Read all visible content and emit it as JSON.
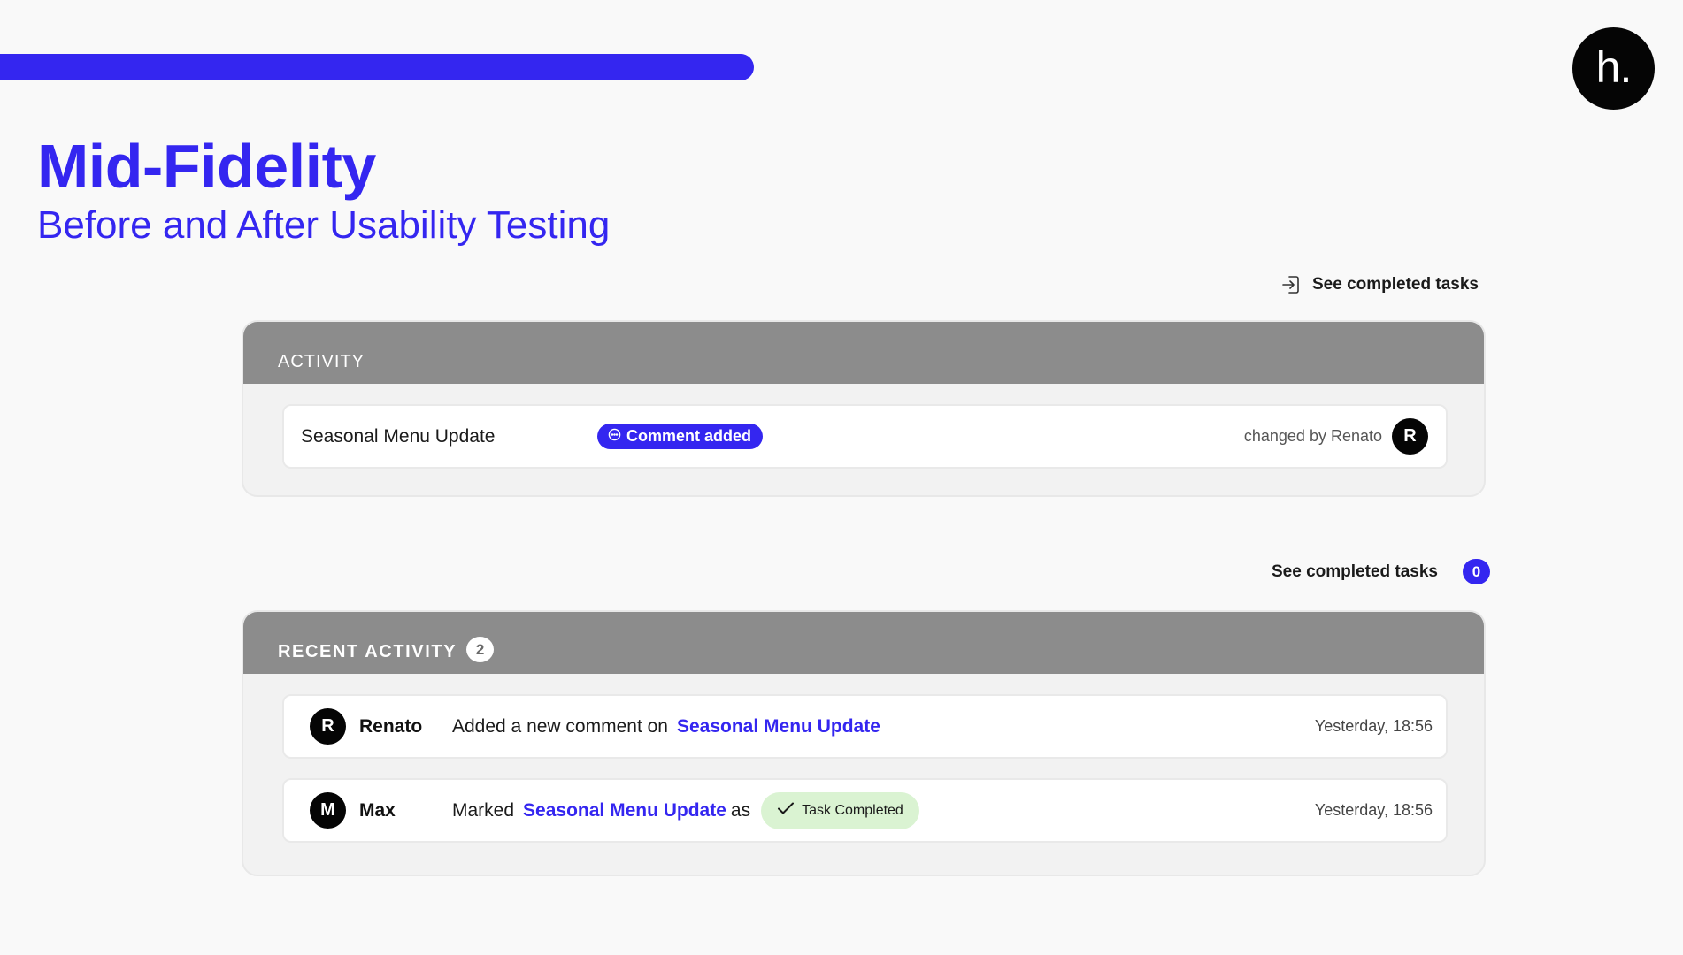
{
  "brand": {
    "logo_text": "h.",
    "accent_color": "#3426f0"
  },
  "page": {
    "title": "Mid-Fidelity",
    "subtitle": "Before and After Usability Testing"
  },
  "before": {
    "link_label": "See completed tasks",
    "link_icon": "exit-arrow-icon",
    "card_header": "ACTIVITY",
    "row": {
      "title": "Seasonal Menu Update",
      "badge_icon": "comment-icon",
      "badge_label": "Comment added",
      "changed_by": "changed by Renato",
      "avatar_initial": "R"
    }
  },
  "after": {
    "link_label": "See completed tasks",
    "link_count": "0",
    "card_header": "RECENT ACTIVITY",
    "card_count": "2",
    "rows": [
      {
        "initial": "R",
        "name": "Renato",
        "text": "Added a new comment on",
        "link": "Seasonal Menu Update",
        "time": "Yesterday, 18:56"
      },
      {
        "initial": "M",
        "name": "Max",
        "text": "Marked",
        "link": "Seasonal Menu Update",
        "after_text": "as",
        "status_icon": "check-icon",
        "status_label": "Task Completed",
        "status_color": "#daf3d2",
        "time": "Yesterday, 18:56"
      }
    ]
  }
}
